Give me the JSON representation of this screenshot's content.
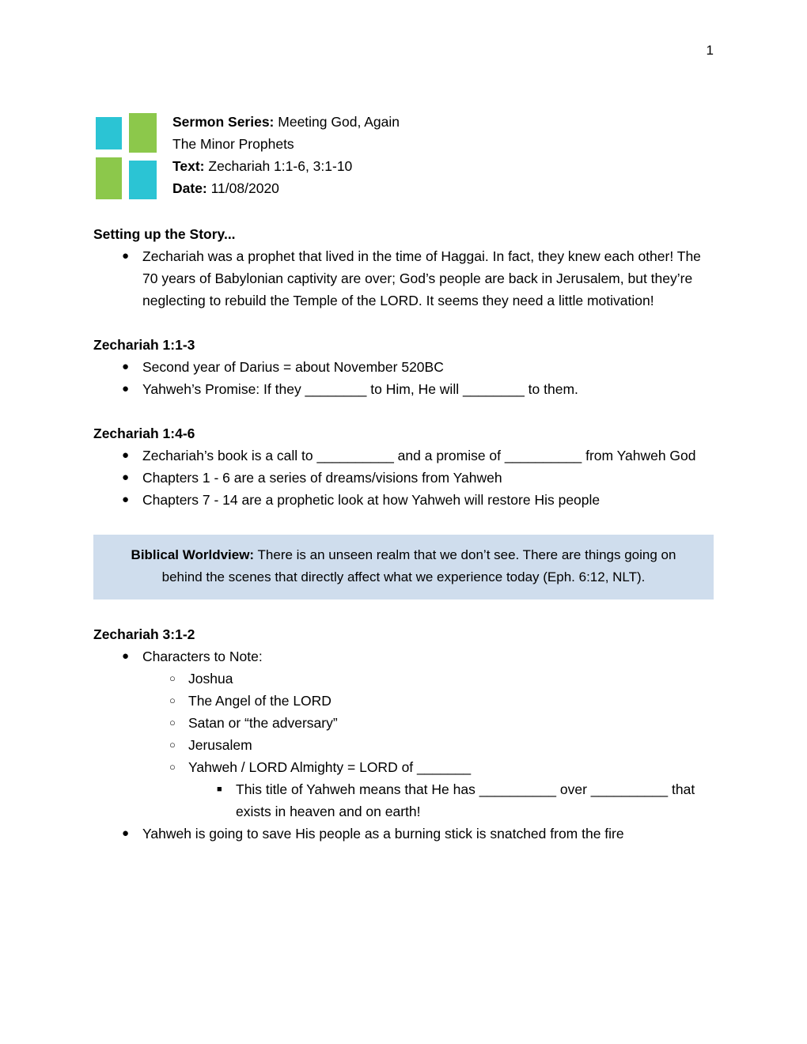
{
  "page": {
    "number": "1"
  },
  "logo": {
    "colors": {
      "teal": "#2bc4d4",
      "green": "#8cc84b"
    },
    "cells": [
      {
        "name": "top-left",
        "color": "#2bc4d4"
      },
      {
        "name": "top-right",
        "color": "#8cc84b"
      },
      {
        "name": "bottom-left",
        "color": "#8cc84b"
      },
      {
        "name": "bottom-right",
        "color": "#2bc4d4"
      }
    ]
  },
  "header": {
    "series_label": "Sermon Series:",
    "series_value": " Meeting God, Again",
    "subtitle": "The Minor Prophets",
    "text_label": "Text:",
    "text_value": " Zechariah 1:1-6, 3:1-10",
    "date_label": "Date:",
    "date_value": " 11/08/2020"
  },
  "sections": [
    {
      "heading": "Setting up the Story...",
      "bullets": [
        "Zechariah was a prophet that lived in the time of Haggai.  In fact, they knew each other!  The 70 years of Babylonian captivity are over; God’s people are back in Jerusalem, but they’re neglecting to rebuild the Temple of the LORD.  It seems they need a little motivation!"
      ]
    },
    {
      "heading": "Zechariah 1:1-3",
      "bullets": [
        "Second year of Darius = about November 520BC",
        "Yahweh’s Promise: If they ________ to Him, He will ________ to them."
      ]
    },
    {
      "heading": "Zechariah 1:4-6",
      "bullets": [
        "Zechariah’s book is a call to __________ and a promise of __________ from Yahweh God",
        "Chapters 1 - 6 are a series of dreams/visions from Yahweh",
        "Chapters 7 - 14 are a prophetic look at how Yahweh will restore His people"
      ]
    }
  ],
  "callout": {
    "label": "Biblical Worldview:",
    "body": " There is an unseen realm that we don’t see. There are things going on behind the scenes that directly affect what we experience today (Eph. 6:12, NLT).",
    "background_color": "#cfdded"
  },
  "last_section": {
    "heading": "Zechariah 3:1-2",
    "bullet1": "Characters to Note:",
    "sub_bullets": [
      "Joshua",
      "The Angel of the LORD",
      "Satan or “the adversary”",
      "Jerusalem",
      "Yahweh / LORD Almighty = LORD of _______"
    ],
    "sub_sub_bullet": "This title of Yahweh means that He has __________ over __________ that exists in heaven and on earth!",
    "bullet2": "Yahweh is going to save His people as a burning stick is snatched from the fire"
  },
  "bullet_glyphs": {
    "level1": "●",
    "level2": "○",
    "level3": "■"
  }
}
